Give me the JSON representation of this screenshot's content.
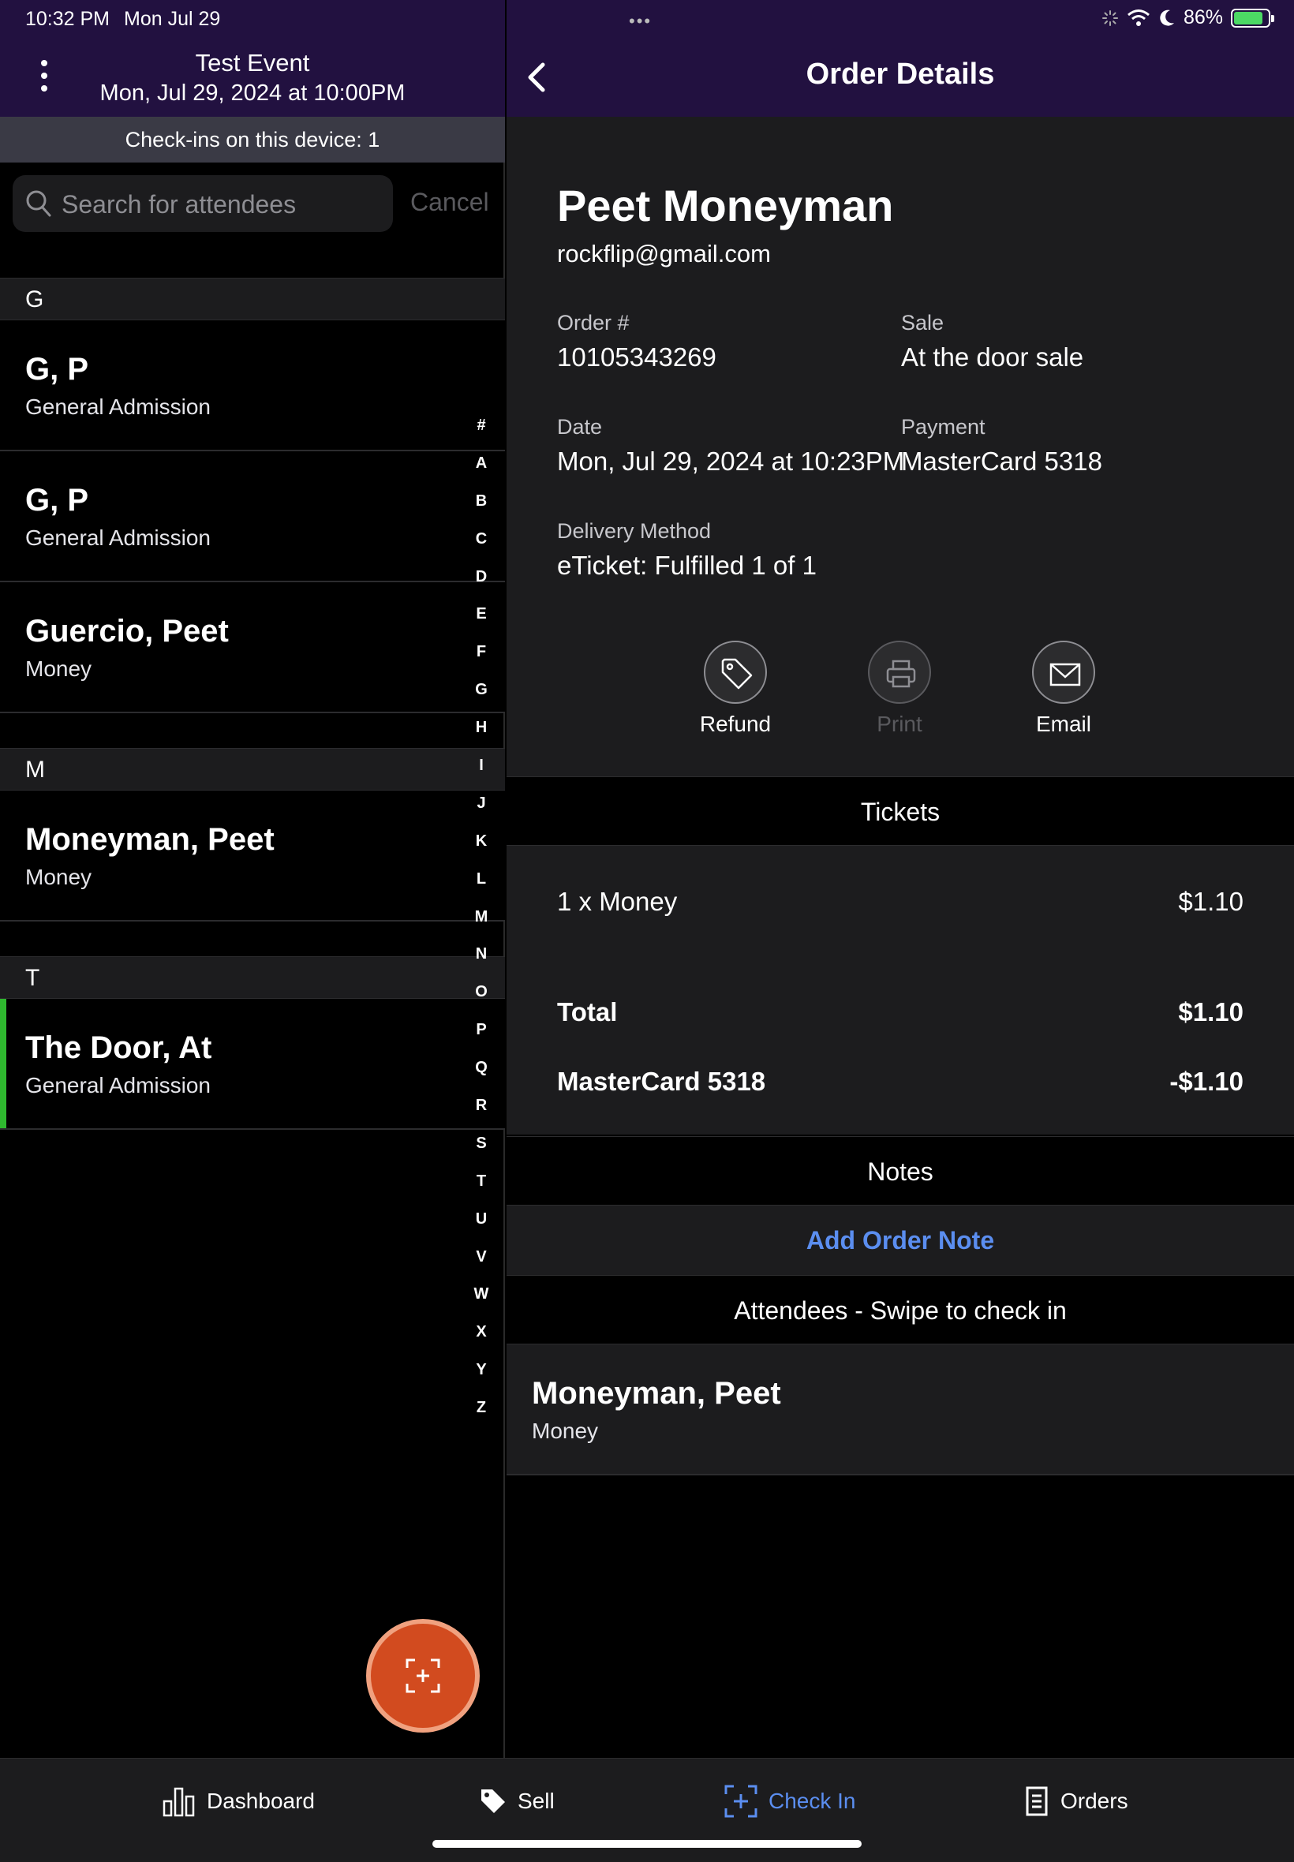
{
  "status_bar": {
    "time": "10:32 PM",
    "date": "Mon Jul 29",
    "battery": "86%",
    "battery_level": 0.86
  },
  "left_pane": {
    "event_title": "Test Event",
    "event_date": "Mon, Jul 29, 2024 at 10:00PM",
    "checkins_text": "Check-ins on this device: 1",
    "search": {
      "placeholder": "Search for attendees",
      "value": ""
    },
    "cancel_label": "Cancel",
    "sections": [
      {
        "letter": "G"
      },
      {
        "letter": "M"
      },
      {
        "letter": "T"
      }
    ],
    "attendees": [
      {
        "name": "G, P",
        "ticket": "General Admission"
      },
      {
        "name": "G, P",
        "ticket": "General Admission"
      },
      {
        "name": "Guercio, Peet",
        "ticket": "Money"
      },
      {
        "name": "Moneyman, Peet",
        "ticket": "Money"
      },
      {
        "name": "The Door, At",
        "ticket": "General Admission",
        "checked_in": true
      }
    ],
    "alphabet_index": [
      "#",
      "A",
      "B",
      "C",
      "D",
      "E",
      "F",
      "G",
      "H",
      "I",
      "J",
      "K",
      "L",
      "M",
      "N",
      "O",
      "P",
      "Q",
      "R",
      "S",
      "T",
      "U",
      "V",
      "W",
      "X",
      "Y",
      "Z"
    ],
    "fab_icon": "scan-add-icon"
  },
  "order": {
    "page_title": "Order Details",
    "customer_name": "Peet Moneyman",
    "customer_email": "rockflip@gmail.com",
    "order_number_label": "Order #",
    "order_number": "10105343269",
    "sale_label": "Sale",
    "sale_value": "At the door sale",
    "date_label": "Date",
    "date_value": "Mon, Jul 29, 2024 at 10:23PM",
    "payment_label": "Payment",
    "payment_value": "MasterCard 5318",
    "delivery_label": "Delivery Method",
    "delivery_value": "eTicket: Fulfilled 1 of 1",
    "actions": {
      "refund": "Refund",
      "print": "Print",
      "email": "Email"
    },
    "tickets_heading": "Tickets",
    "ticket_line": {
      "description": "1 x Money",
      "amount": "$1.10"
    },
    "total_label": "Total",
    "total_amount": "$1.10",
    "payment_line_label": "MasterCard 5318",
    "payment_line_amount": "-$1.10",
    "notes_heading": "Notes",
    "add_note_label": "Add Order Note",
    "attendees_heading": "Attendees - Swipe to check in",
    "attendee": {
      "name": "Moneyman, Peet",
      "ticket": "Money"
    }
  },
  "tab_bar": {
    "tabs": [
      {
        "label": "Dashboard",
        "icon": "bar-chart-icon"
      },
      {
        "label": "Sell",
        "icon": "tag-icon"
      },
      {
        "label": "Check In",
        "icon": "scan-add-icon",
        "active": true
      },
      {
        "label": "Orders",
        "icon": "receipt-icon"
      }
    ]
  },
  "colors": {
    "header_purple": "#221140",
    "accent_blue": "#5b8ef0",
    "fab_orange": "#d24b1f",
    "checked_green": "#2fb82f"
  }
}
